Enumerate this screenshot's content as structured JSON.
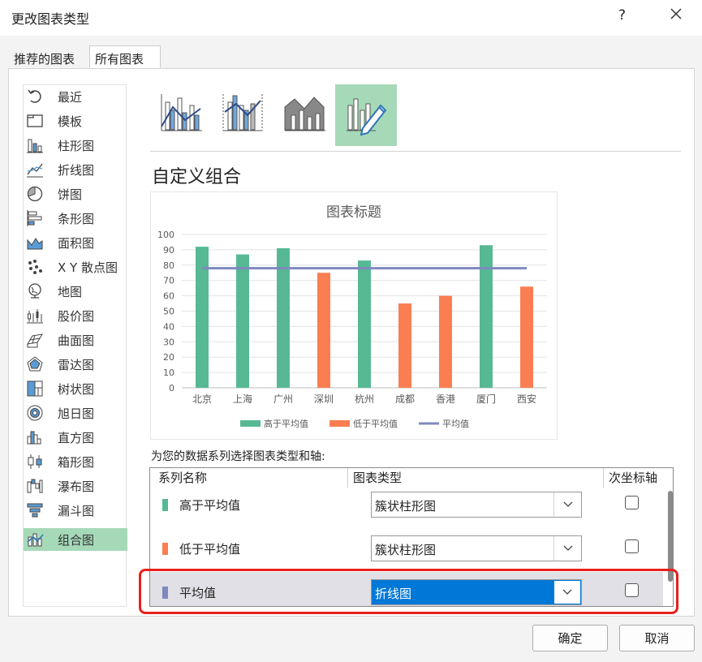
{
  "window": {
    "title": "更改图表类型",
    "help": "?"
  },
  "tabs": [
    {
      "label": "推荐的图表"
    },
    {
      "label": "所有图表"
    }
  ],
  "sidebar": {
    "items": [
      {
        "label": "最近",
        "icon": "recent-icon"
      },
      {
        "label": "模板",
        "icon": "template-icon"
      },
      {
        "label": "柱形图",
        "icon": "column-chart-icon"
      },
      {
        "label": "折线图",
        "icon": "line-chart-icon"
      },
      {
        "label": "饼图",
        "icon": "pie-chart-icon"
      },
      {
        "label": "条形图",
        "icon": "bar-chart-icon"
      },
      {
        "label": "面积图",
        "icon": "area-chart-icon"
      },
      {
        "label": "X Y 散点图",
        "icon": "scatter-chart-icon"
      },
      {
        "label": "地图",
        "icon": "map-chart-icon"
      },
      {
        "label": "股价图",
        "icon": "stock-chart-icon"
      },
      {
        "label": "曲面图",
        "icon": "surface-chart-icon"
      },
      {
        "label": "雷达图",
        "icon": "radar-chart-icon"
      },
      {
        "label": "树状图",
        "icon": "treemap-chart-icon"
      },
      {
        "label": "旭日图",
        "icon": "sunburst-chart-icon"
      },
      {
        "label": "直方图",
        "icon": "histogram-chart-icon"
      },
      {
        "label": "箱形图",
        "icon": "box-whisker-chart-icon"
      },
      {
        "label": "瀑布图",
        "icon": "waterfall-chart-icon"
      },
      {
        "label": "漏斗图",
        "icon": "funnel-chart-icon"
      },
      {
        "label": "组合图",
        "icon": "combo-chart-icon"
      }
    ],
    "selected": "组合图"
  },
  "subtypes": [
    {
      "icon": "clustered-column-line-icon"
    },
    {
      "icon": "clustered-column-line-secondary-axis-icon"
    },
    {
      "icon": "stacked-area-clustered-column-icon"
    },
    {
      "icon": "custom-combination-icon"
    }
  ],
  "heading": "自定义组合",
  "chart_data": {
    "type": "bar",
    "title": "图表标题",
    "categories": [
      "北京",
      "上海",
      "广州",
      "深圳",
      "杭州",
      "成都",
      "香港",
      "厦门",
      "西安"
    ],
    "ylim": [
      0,
      100
    ],
    "yticks": [
      "0",
      "10",
      "20",
      "30",
      "40",
      "50",
      "60",
      "70",
      "80",
      "90",
      "100"
    ],
    "grid": true,
    "legend_position": "bottom",
    "series": [
      {
        "name": "高于平均值",
        "type": "bar",
        "color": "#57b994",
        "values": [
          92,
          87,
          91,
          null,
          83,
          null,
          null,
          93,
          null
        ]
      },
      {
        "name": "低于平均值",
        "type": "bar",
        "color": "#fa7e51",
        "values": [
          null,
          null,
          null,
          75,
          null,
          55,
          60,
          null,
          66
        ]
      },
      {
        "name": "平均值",
        "type": "line",
        "color": "#7f89c0",
        "values": [
          78,
          78,
          78,
          78,
          78,
          78,
          78,
          78,
          78
        ]
      }
    ]
  },
  "series_prompt": "为您的数据系列选择图表类型和轴:",
  "series_table": {
    "headers": {
      "name": "系列名称",
      "type": "图表类型",
      "secondary": "次坐标轴"
    },
    "rows": [
      {
        "name": "高于平均值",
        "color": "#57b994",
        "chart_type": "簇状柱形图",
        "secondary": false
      },
      {
        "name": "低于平均值",
        "color": "#fa7e51",
        "chart_type": "簇状柱形图",
        "secondary": false
      },
      {
        "name": "平均值",
        "color": "#7f89c0",
        "chart_type": "折线图",
        "secondary": false
      }
    ]
  },
  "buttons": {
    "ok": "确定",
    "cancel": "取消"
  }
}
